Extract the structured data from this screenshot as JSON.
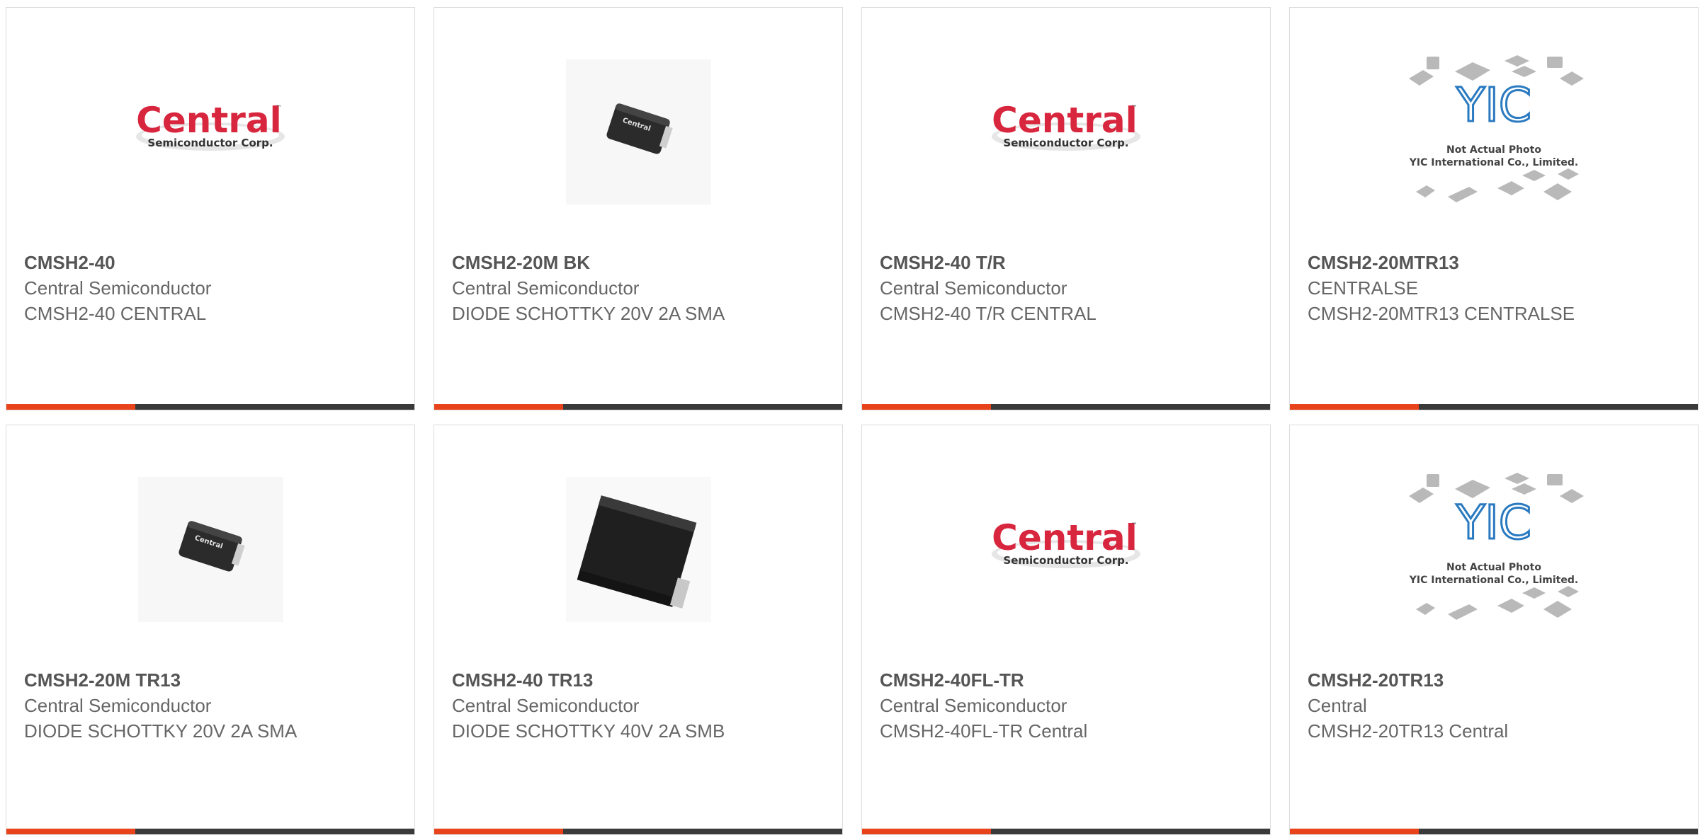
{
  "products": [
    {
      "part": "CMSH2-40",
      "manufacturer": "Central Semiconductor",
      "description": "CMSH2-40 CENTRAL",
      "image": "central-logo"
    },
    {
      "part": "CMSH2-20M BK",
      "manufacturer": "Central Semiconductor",
      "description": "DIODE SCHOTTKY 20V 2A SMA",
      "image": "sma-chip-photo"
    },
    {
      "part": "CMSH2-40 T/R",
      "manufacturer": "Central Semiconductor",
      "description": "CMSH2-40 T/R CENTRAL",
      "image": "central-logo"
    },
    {
      "part": "CMSH2-20MTR13",
      "manufacturer": "CENTRALSE",
      "description": "CMSH2-20MTR13 CENTRALSE",
      "image": "yic-placeholder"
    },
    {
      "part": "CMSH2-20M TR13",
      "manufacturer": "Central Semiconductor",
      "description": "DIODE SCHOTTKY 20V 2A SMA",
      "image": "sma-chip-photo"
    },
    {
      "part": "CMSH2-40 TR13",
      "manufacturer": "Central Semiconductor",
      "description": "DIODE SCHOTTKY 40V 2A SMB",
      "image": "smb-chip-photo"
    },
    {
      "part": "CMSH2-40FL-TR",
      "manufacturer": "Central Semiconductor",
      "description": "CMSH2-40FL-TR Central",
      "image": "central-logo"
    },
    {
      "part": "CMSH2-20TR13",
      "manufacturer": "Central",
      "description": "CMSH2-20TR13 Central",
      "image": "yic-placeholder"
    }
  ],
  "logo": {
    "brand": "Central",
    "tm": "™",
    "sub": "Semiconductor Corp."
  },
  "chip_marking": "Central",
  "yic": {
    "mark": "YIC",
    "line1": "Not Actual Photo",
    "line2": "YIC International Co., Limited."
  },
  "colors": {
    "accent": "#e8431a",
    "bar": "#3a3a3a",
    "brand_red": "#d7263d"
  }
}
